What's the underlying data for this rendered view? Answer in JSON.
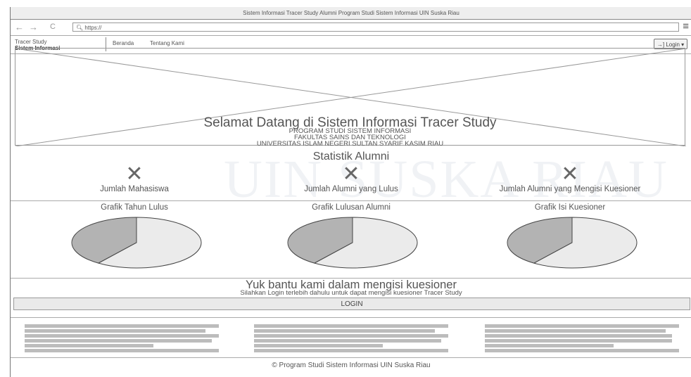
{
  "browser": {
    "title": "Sistem Informasi Tracer Study Alumni Program Studi Sistem Informasi UIN Suska Riau",
    "url": "https://",
    "back_icon": "←",
    "forward_icon": "→",
    "reload_icon": "C",
    "search_icon": "🔍︎",
    "menu_icon": "≡"
  },
  "header": {
    "brand_line1": "Tracer Study",
    "brand_line2": "Sistem Informasi",
    "nav": [
      "Beranda",
      "Tentang Kami"
    ],
    "login_icon": "→]",
    "login_label": "Login ▾"
  },
  "hero": {
    "title": "Selamat Datang di Sistem Informasi Tracer Study",
    "line1": "PROGRAM STUDI SISTEM INFORMASI",
    "line2": "FAKULTAS SAINS DAN TEKNOLOGI",
    "line3": "UNIVERSITAS ISLAM NEGERI SULTAN SYARIF KASIM RIAU"
  },
  "stats": {
    "title": "Statistik Alumni",
    "items": [
      {
        "icon": "✕",
        "label": "Jumlah Mahasiswa"
      },
      {
        "icon": "✕",
        "label": "Jumlah Alumni yang Lulus"
      },
      {
        "icon": "✕",
        "label": "Jumlah Alumni yang Mengisi Kuesioner"
      }
    ]
  },
  "charts": {
    "titles": [
      "Grafik Tahun Lulus",
      "Grafik Lulusan Alumni",
      "Grafik Isi Kuesioner"
    ],
    "slice_dark": "#b3b3b3",
    "slice_light": "#ebebeb"
  },
  "chart_data": [
    {
      "type": "pie",
      "title": "Grafik Tahun Lulus",
      "values": [
        0.4,
        0.6
      ]
    },
    {
      "type": "pie",
      "title": "Grafik Lulusan Alumni",
      "values": [
        0.4,
        0.6
      ]
    },
    {
      "type": "pie",
      "title": "Grafik Isi Kuesioner",
      "values": [
        0.4,
        0.6
      ]
    }
  ],
  "cta": {
    "title": "Yuk bantu kami dalam mengisi kuesioner",
    "subtitle": "Silahkan Login terlebih dahulu untuk dapat mengisi kuesioner Tracer Study",
    "button": "LOGIN"
  },
  "watermark": {
    "text": "UIN SUSKA RIAU"
  },
  "footer": {
    "copyright": "© Program Studi Sistem Informasi UIN Suska Riau"
  }
}
